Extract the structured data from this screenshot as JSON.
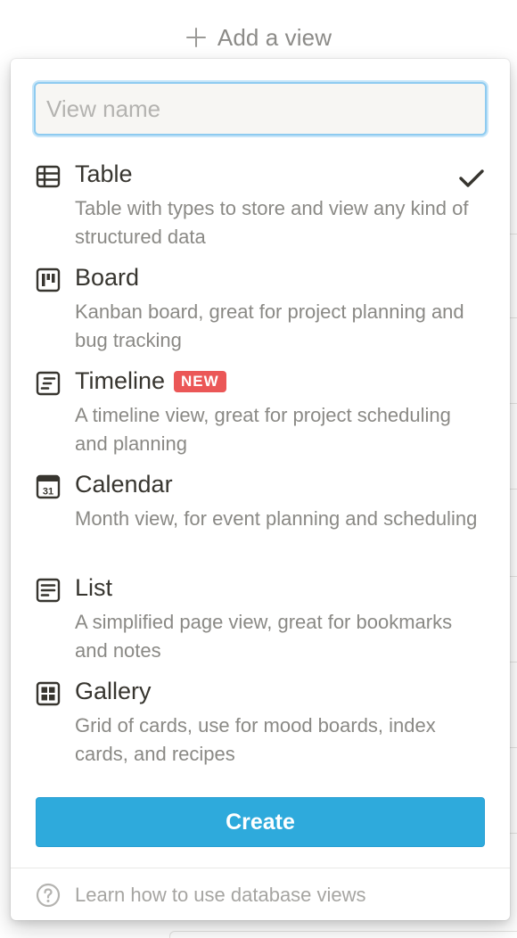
{
  "header": {
    "add_view_label": "Add a view",
    "icon": "plus-icon"
  },
  "search": {
    "value": "",
    "placeholder": "View name"
  },
  "view_types": [
    {
      "title": "Table",
      "description": "Table with types to store and view any kind of structured data",
      "icon": "table-icon",
      "selected": true
    },
    {
      "title": "Board",
      "description": "Kanban board, great for project planning and bug tracking",
      "icon": "board-icon",
      "selected": false
    },
    {
      "title": "Timeline",
      "badge": "NEW",
      "description": "A timeline view, great for project scheduling and planning",
      "icon": "timeline-icon",
      "selected": false
    },
    {
      "title": "Calendar",
      "description": "Month view, for event planning and scheduling",
      "icon": "calendar-icon",
      "icon_text": "31",
      "selected": false
    },
    {
      "title": "List",
      "description": "A simplified page view, great for bookmarks and notes",
      "icon": "list-icon",
      "selected": false
    },
    {
      "title": "Gallery",
      "description": "Grid of cards, use for mood boards, index cards, and recipes",
      "icon": "gallery-icon",
      "selected": false
    }
  ],
  "create_button": {
    "label": "Create"
  },
  "footer": {
    "help_text": "Learn how to use database views",
    "icon": "help-circle-icon"
  },
  "colors": {
    "accent": "#2eaadc",
    "badge_new": "#eb5757",
    "text_primary": "#37352f",
    "text_secondary": "#8a8985",
    "input_focus": "#8ecbf0"
  }
}
